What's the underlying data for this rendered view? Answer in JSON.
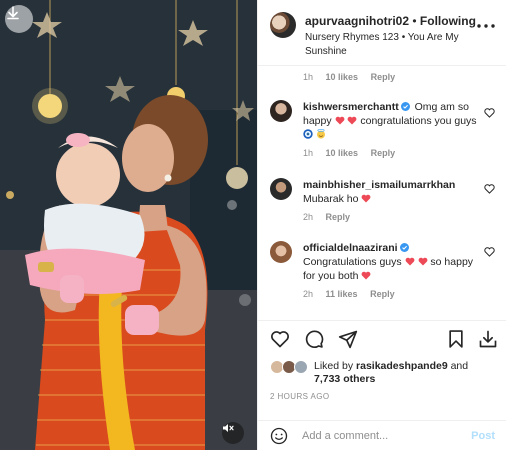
{
  "colors": {
    "verified": "#3897f0",
    "heart_red": "#ed4956",
    "link_blue": "#b2dffc",
    "muted": "#8e8e8e",
    "text": "#262626"
  },
  "media": {
    "download_icon": "download-arrow-icon",
    "mute_icon": "speaker-muted-icon"
  },
  "post": {
    "username": "apurvaagnihotri02",
    "separator": "•",
    "follow_status": "Following",
    "audio": "Nursery Rhymes 123 • You Are My Sunshine",
    "more_icon": "more-options-icon"
  },
  "comments": [
    {
      "username": "",
      "text": "",
      "time": "1h",
      "likes": "10 likes",
      "reply": "Reply"
    },
    {
      "username": "kishwersmerchantt",
      "verified": true,
      "text_before": "Omg am so happy",
      "text_after": "congratulations you guys",
      "time": "1h",
      "likes": "10 likes",
      "reply": "Reply"
    },
    {
      "username": "mainbhisher_ismailumarrkhan",
      "verified": false,
      "text_before": "Mubarak ho",
      "time": "2h",
      "reply": "Reply"
    },
    {
      "username": "officialdelnaazirani",
      "verified": true,
      "text_before": "Congratulations guys",
      "text_after": "so happy for you both",
      "time": "2h",
      "likes": "11 likes",
      "reply": "Reply"
    }
  ],
  "actions": {
    "like_icon": "heart-icon",
    "comment_icon": "comment-icon",
    "share_icon": "share-icon",
    "save_icon": "bookmark-icon",
    "download_icon": "download-icon"
  },
  "likes": {
    "prefix": "Liked by",
    "user": "rasikadeshpande9",
    "connector": "and",
    "others": "7,733 others"
  },
  "date": "2 HOURS AGO",
  "add_comment": {
    "placeholder": "Add a comment...",
    "post_label": "Post"
  }
}
